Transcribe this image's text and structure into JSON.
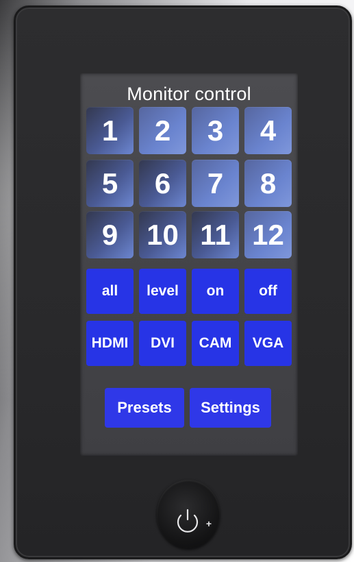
{
  "panel": {
    "title": "Monitor control"
  },
  "monitors": [
    "1",
    "2",
    "3",
    "4",
    "5",
    "6",
    "7",
    "8",
    "9",
    "10",
    "11",
    "12"
  ],
  "actions": [
    "all",
    "level",
    "on",
    "off"
  ],
  "sources": [
    "HDMI",
    "DVI",
    "CAM",
    "VGA"
  ],
  "footer": {
    "presets_label": "Presets",
    "settings_label": "Settings"
  },
  "power_button": {
    "icon": "power-plus-icon",
    "plus_label": "+"
  },
  "colors": {
    "button_blue": "#2734e6",
    "tile_blue_dark": "#33384f",
    "tile_blue_light": "#7f97db",
    "device_body": "#2d2d2f"
  }
}
